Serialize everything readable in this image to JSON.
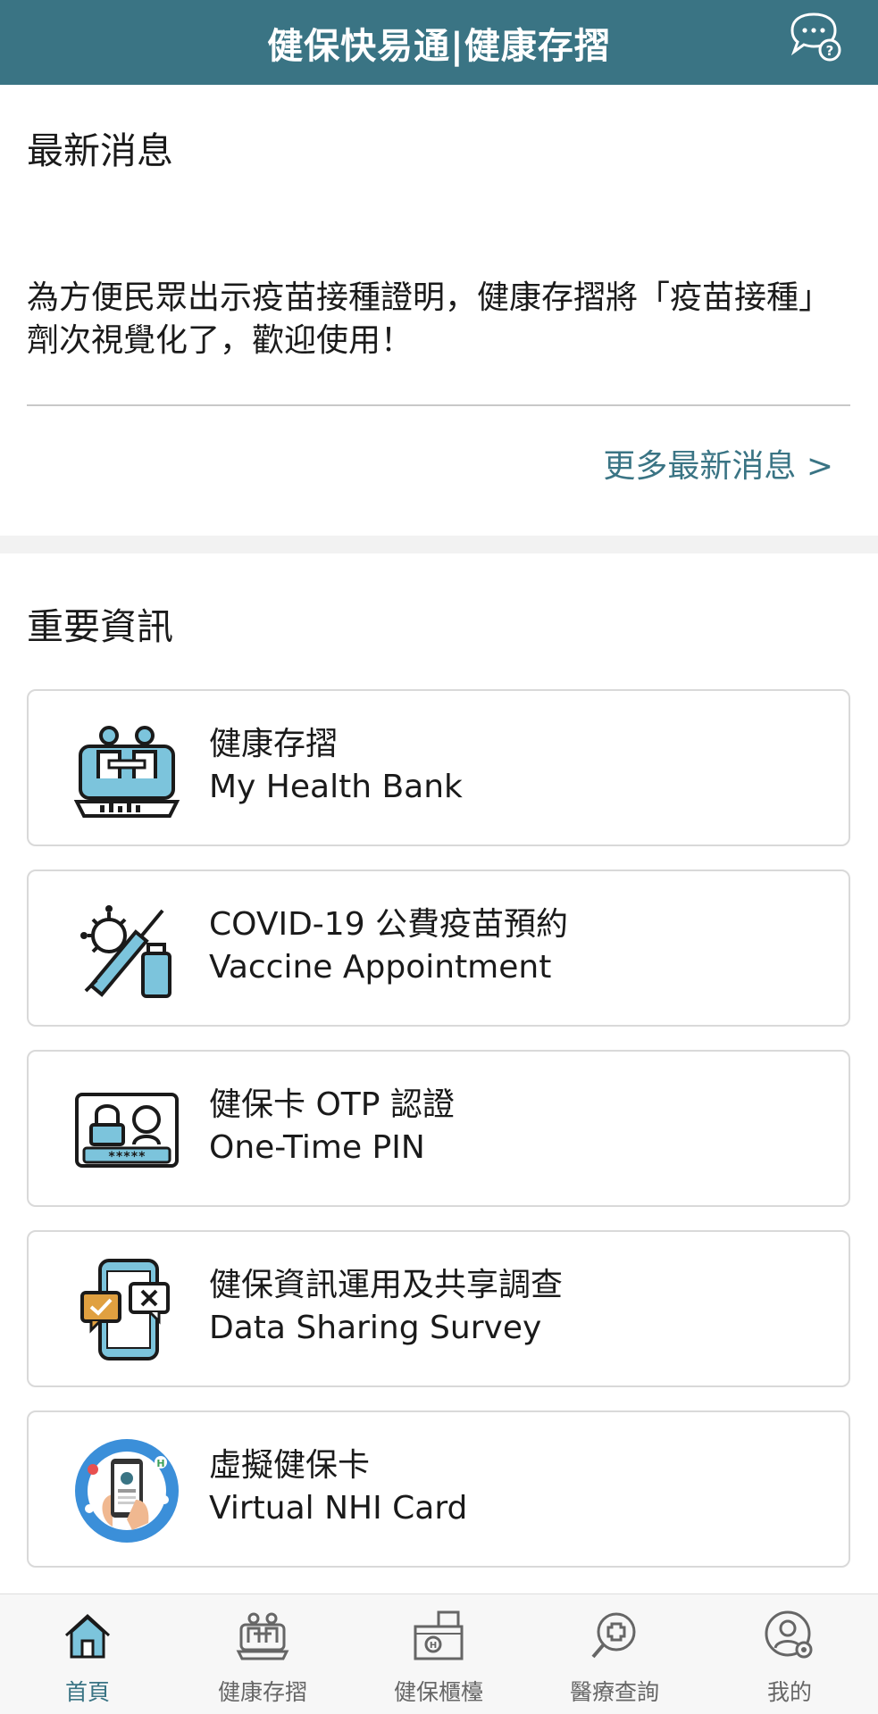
{
  "header": {
    "title": "健保快易通|健康存摺",
    "chat_icon": "chat-help-icon"
  },
  "news": {
    "title": "最新消息",
    "text": "為方便民眾出示疫苗接種證明，健康存摺將「疫苗接種」劑次視覺化了，歡迎使用！",
    "more_label": "更多最新消息 >"
  },
  "info": {
    "title": "重要資訊",
    "cards": [
      {
        "label": "健康存摺",
        "sub": "My Health Bank",
        "icon": "health-bank-icon"
      },
      {
        "label": "COVID-19 公費疫苗預約",
        "sub": "Vaccine Appointment",
        "icon": "vaccine-icon"
      },
      {
        "label": "健保卡 OTP 認證",
        "sub": "One-Time PIN",
        "icon": "otp-lock-icon"
      },
      {
        "label": "健保資訊運用及共享調查",
        "sub": "Data Sharing Survey",
        "icon": "survey-phone-icon"
      },
      {
        "label": "虛擬健保卡",
        "sub": "Virtual NHI Card",
        "icon": "virtual-card-icon"
      }
    ]
  },
  "tabbar": {
    "items": [
      {
        "label": "首頁",
        "icon": "home-icon",
        "active": true
      },
      {
        "label": "健康存摺",
        "icon": "health-bank-tab-icon",
        "active": false
      },
      {
        "label": "健保櫃檯",
        "icon": "counter-icon",
        "active": false
      },
      {
        "label": "醫療查詢",
        "icon": "medical-search-icon",
        "active": false
      },
      {
        "label": "我的",
        "icon": "profile-settings-icon",
        "active": false
      }
    ]
  },
  "colors": {
    "brand": "#3a7484",
    "accent_light": "#7cc4dc",
    "accent_orange": "#e0a040"
  }
}
